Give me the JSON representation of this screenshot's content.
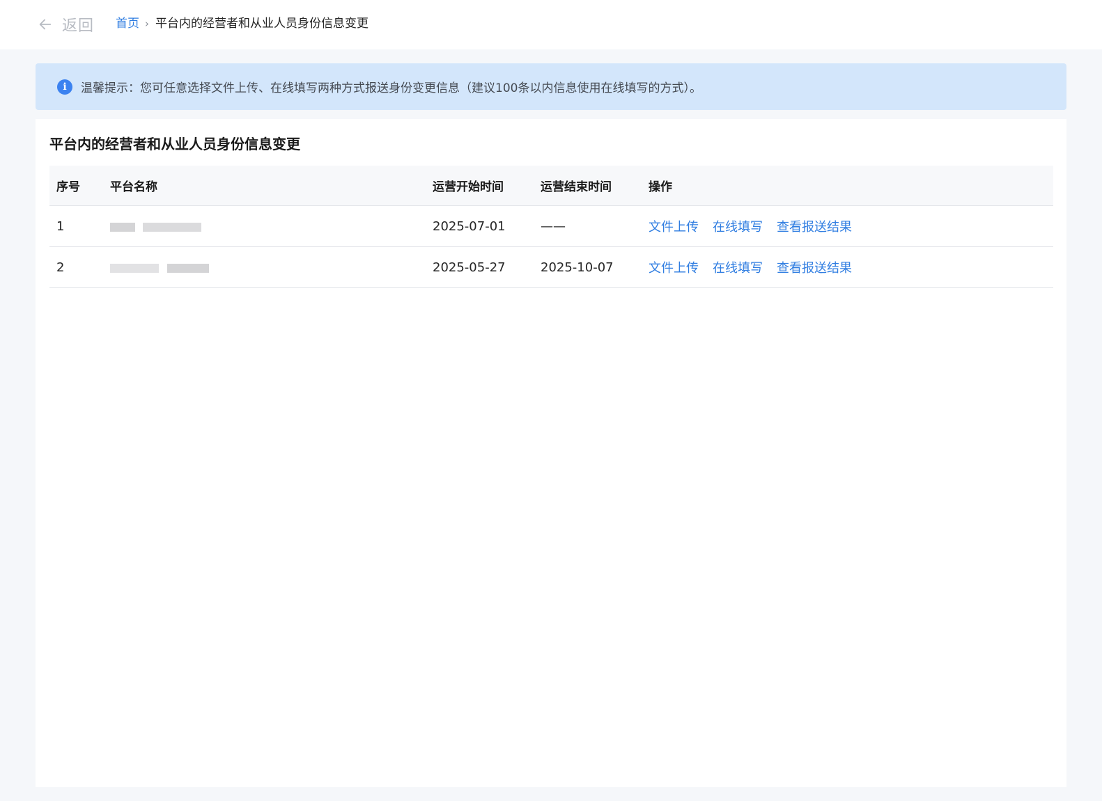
{
  "header": {
    "back_label": "返回",
    "breadcrumb": {
      "home": "首页",
      "separator": "›",
      "current": "平台内的经营者和从业人员身份信息变更"
    }
  },
  "tip": {
    "icon": "info-icon",
    "text": "温馨提示：您可任意选择文件上传、在线填写两种方式报送身份变更信息（建议100条以内信息使用在线填写的方式）。"
  },
  "card": {
    "title": "平台内的经营者和从业人员身份信息变更"
  },
  "table": {
    "columns": [
      "序号",
      "平台名称",
      "运营开始时间",
      "运营结束时间",
      "操作"
    ],
    "rows": [
      {
        "index": "1",
        "platform_name": "",
        "start": "2025-07-01",
        "end": "——",
        "actions": [
          "文件上传",
          "在线填写",
          "查看报送结果"
        ]
      },
      {
        "index": "2",
        "platform_name": "",
        "start": "2025-05-27",
        "end": "2025-10-07",
        "actions": [
          "文件上传",
          "在线填写",
          "查看报送结果"
        ]
      }
    ]
  },
  "colors": {
    "link": "#2f7de1",
    "tip_background": "#d3e6fb",
    "info_icon": "#3b82f0",
    "page_background": "#f5f7fa"
  }
}
